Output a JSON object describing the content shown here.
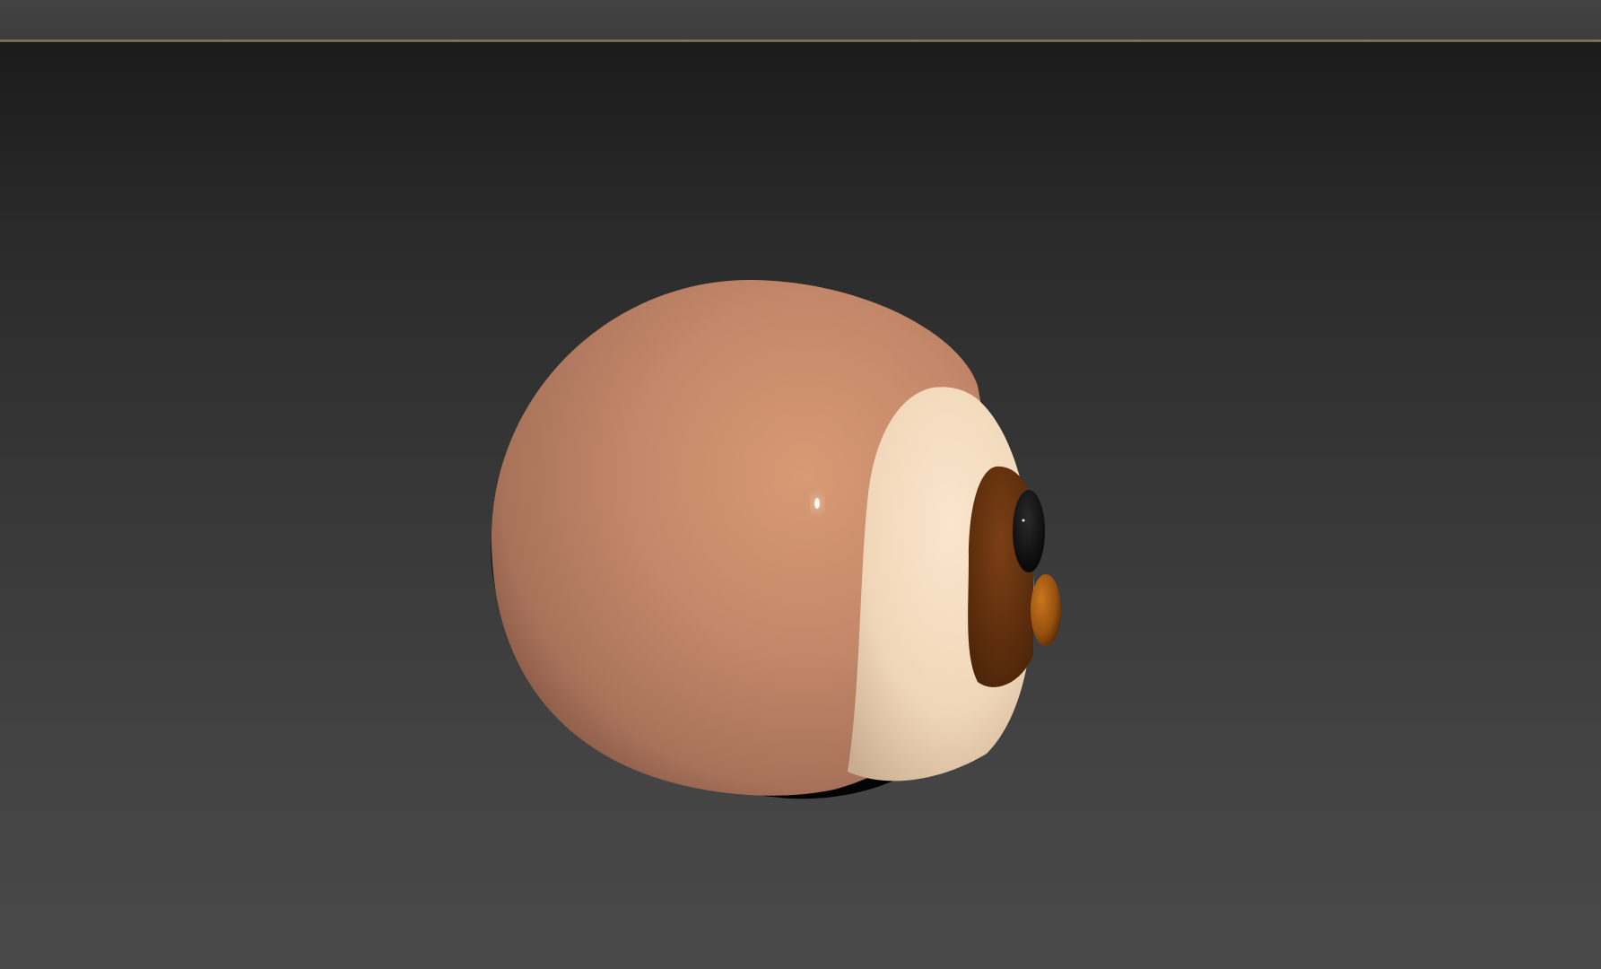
{
  "app": {
    "type": "3d-viewport",
    "top_bar_color": "#414141",
    "viewport_border_color": "#8a7f4a",
    "viewport_background": [
      "#1b1b1b",
      "#494949"
    ]
  },
  "scene": {
    "object": "sloth-head-model",
    "colors": {
      "fur": "#c4886a",
      "face": "#f3dcc0",
      "eye-patch": "#6a3512",
      "eye": "#0d0d0d",
      "nose": "#a65a14",
      "shadow": "#000000"
    }
  }
}
